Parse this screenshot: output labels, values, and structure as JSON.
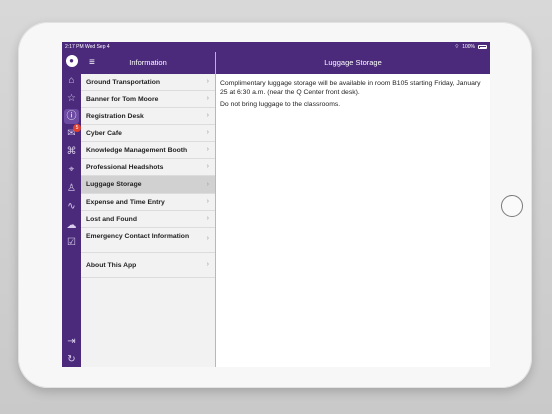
{
  "statusbar": {
    "time_date": "2:17 PM  Wed Sep 4",
    "signal": "ᴼ ᵛ",
    "wifi": "▼",
    "battery": "100%"
  },
  "header": {
    "menu_icon": "menu-icon",
    "list_title": "Information",
    "detail_title": "Luggage Storage"
  },
  "rail": {
    "icons": [
      {
        "name": "avatar-icon",
        "glyph": "☺"
      },
      {
        "name": "home-icon",
        "glyph": "⌂"
      },
      {
        "name": "star-icon",
        "glyph": "☆"
      },
      {
        "name": "info-icon",
        "glyph": "ⓘ"
      },
      {
        "name": "mail-icon",
        "glyph": "✉",
        "badge": "5"
      },
      {
        "name": "badge-icon",
        "glyph": "⌘"
      },
      {
        "name": "location-icon",
        "glyph": "⌖"
      },
      {
        "name": "people-icon",
        "glyph": "☻"
      },
      {
        "name": "activity-icon",
        "glyph": "∿"
      },
      {
        "name": "chat-icon",
        "glyph": "☷"
      },
      {
        "name": "checklist-icon",
        "glyph": "☑"
      },
      {
        "name": "logout-icon",
        "glyph": "⇥"
      },
      {
        "name": "sync-icon",
        "glyph": "↻"
      }
    ]
  },
  "list": {
    "items": [
      {
        "label": "Ground Transportation"
      },
      {
        "label": "Banner for Tom Moore"
      },
      {
        "label": "Registration Desk"
      },
      {
        "label": "Cyber Cafe"
      },
      {
        "label": "Knowledge Management Booth"
      },
      {
        "label": "Professional Headshots"
      },
      {
        "label": "Luggage Storage",
        "selected": true
      },
      {
        "label": "Expense and Time Entry"
      },
      {
        "label": "Lost and Found"
      },
      {
        "label": "Emergency Contact Information"
      },
      {
        "label": "About This App"
      }
    ],
    "chevron": "›"
  },
  "detail": {
    "paragraphs": [
      "Complimentary luggage storage will be available in room B105 starting Friday, January 25 at 6:30 a.m. (near the Q Center front desk).",
      "Do not bring luggage to the classrooms."
    ]
  }
}
